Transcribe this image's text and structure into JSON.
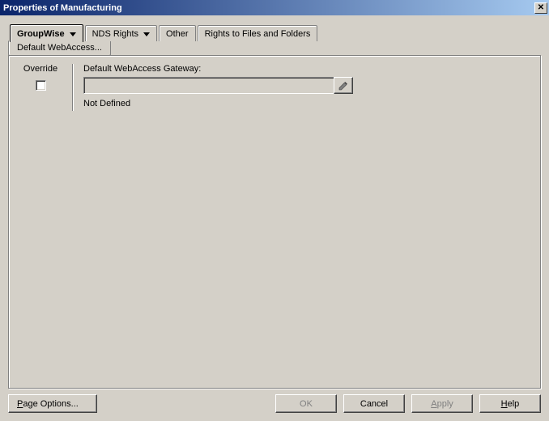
{
  "window": {
    "title": "Properties of Manufacturing",
    "close_glyph": "✕"
  },
  "tabs": {
    "groupwise": "GroupWise",
    "nds_rights": "NDS Rights",
    "other": "Other",
    "rights_files": "Rights to Files and Folders",
    "subtab": "Default WebAccess..."
  },
  "content": {
    "override_label": "Override",
    "gateway_label": "Default WebAccess Gateway:",
    "gateway_value": "",
    "not_defined": "Not Defined"
  },
  "buttons": {
    "page_options": "Page Options...",
    "ok": "OK",
    "cancel": "Cancel",
    "apply": "Apply",
    "help": "Help"
  }
}
